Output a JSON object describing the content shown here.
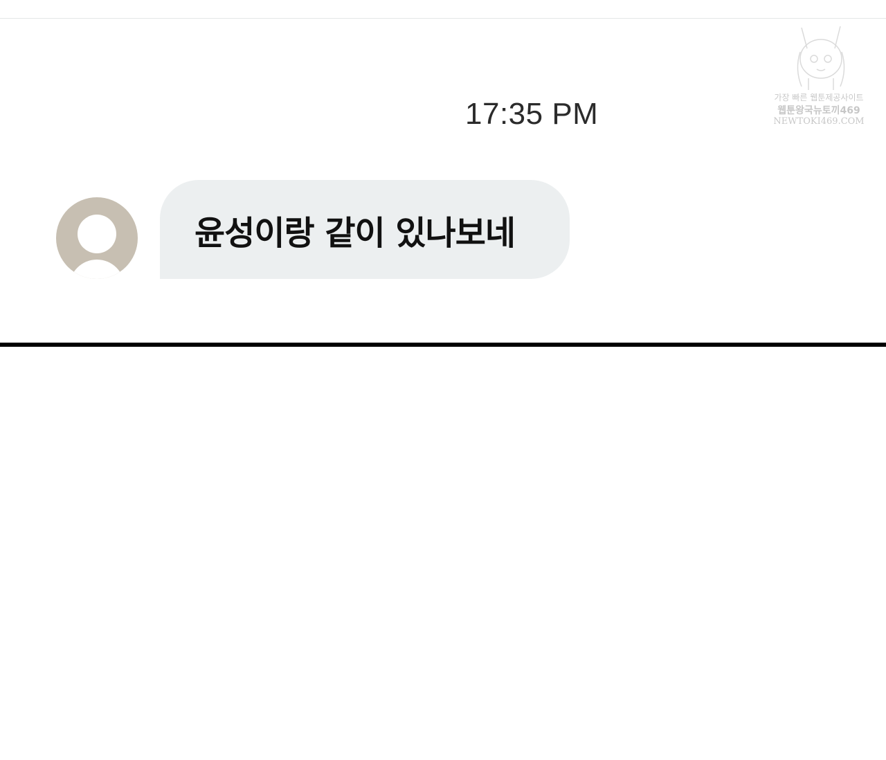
{
  "chat": {
    "timestamp": "17:35 PM",
    "messages": [
      {
        "sender": "incoming",
        "avatar": "default-user-avatar",
        "text": "윤성이랑 같이 있나보네"
      }
    ]
  },
  "watermark": {
    "line1": "가장 빠른 웹툰제공사이트",
    "line2": "웹툰왕국뉴토끼469",
    "line3": "NEWTOKI469.COM"
  },
  "colors": {
    "bubble": "#eceff0",
    "avatar": "#c7bfb2",
    "divider": "#000000",
    "timestamp_text": "#2b2b2b"
  }
}
